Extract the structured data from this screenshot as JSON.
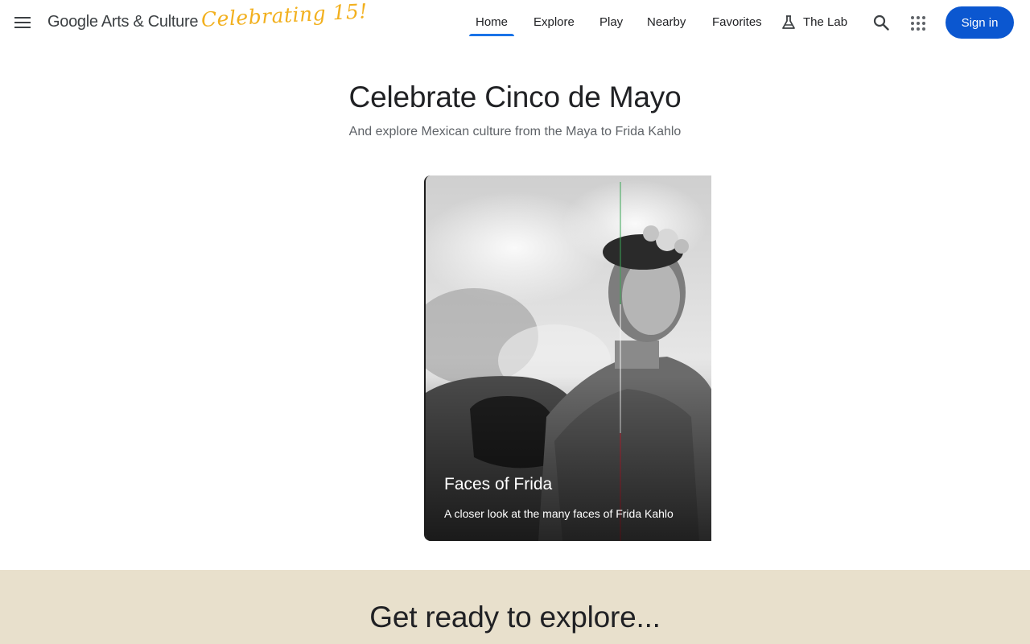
{
  "header": {
    "logo_google": "Google",
    "logo_rest": " Arts & Culture",
    "celebrating": "Celebrating 15!",
    "nav": [
      {
        "label": "Home",
        "active": true
      },
      {
        "label": "Explore"
      },
      {
        "label": "Play"
      },
      {
        "label": "Nearby"
      },
      {
        "label": "Favorites"
      },
      {
        "label": "The Lab"
      }
    ],
    "sign_in": "Sign in",
    "icons": {
      "menu": "hamburger-menu-icon",
      "lab": "flask-icon",
      "search": "search-icon",
      "apps": "apps-grid-icon"
    }
  },
  "hero": {
    "title": "Celebrate Cinco de Mayo",
    "subtitle": "And explore Mexican culture from the Maya to Frida Kahlo"
  },
  "card": {
    "title": "Faces of Frida",
    "subtitle": "A closer look at the many faces of Frida Kahlo"
  },
  "band": {
    "title": "Get ready to explore..."
  },
  "colors": {
    "accent": "#1a73e8",
    "sign_in_bg": "#0b57d0",
    "celebrating": "#f2b01e",
    "band_bg": "#e8e0cc"
  }
}
